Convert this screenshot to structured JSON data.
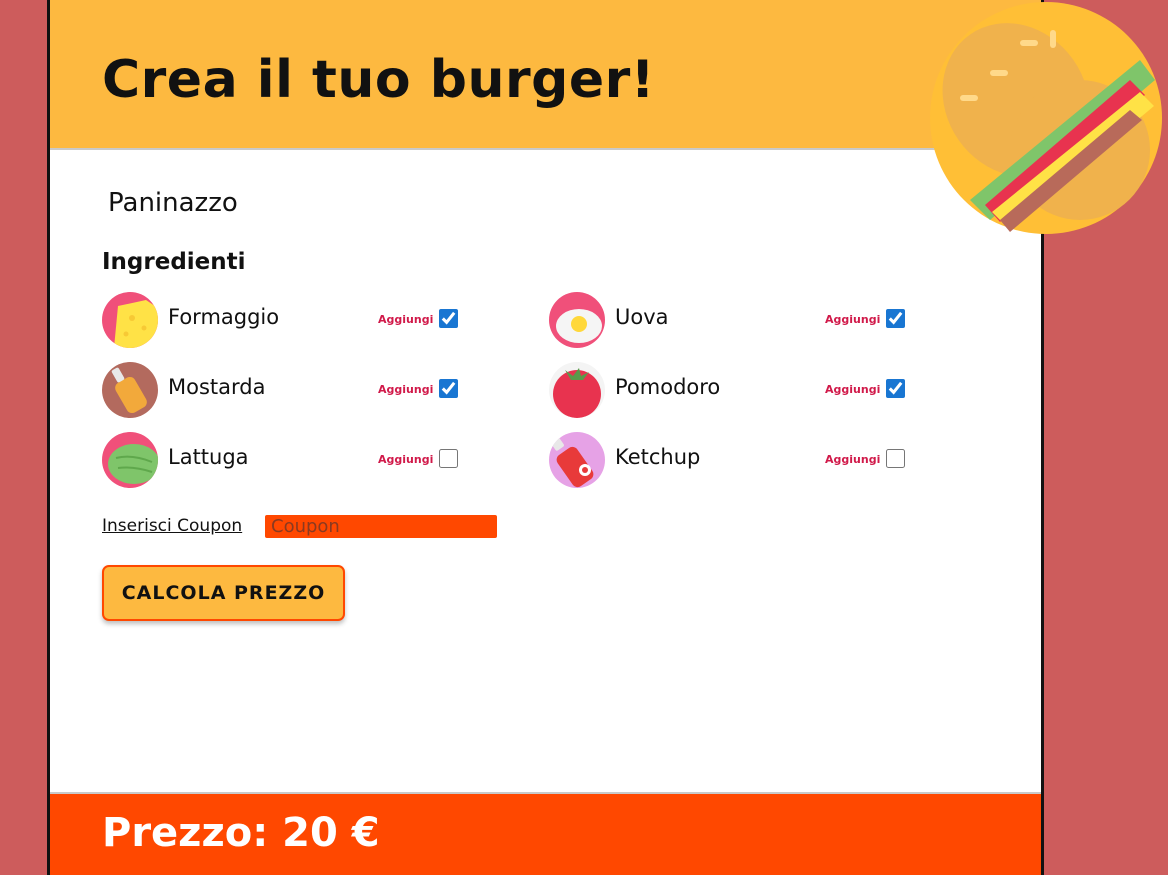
{
  "header": {
    "title": "Crea il tuo burger!"
  },
  "product": {
    "name": "Paninazzo"
  },
  "ingredients_section": {
    "title": "Ingredienti"
  },
  "ingredients": [
    {
      "name": "Formaggio",
      "add_label": "Aggiungi",
      "checked": true,
      "icon": "cheese-icon"
    },
    {
      "name": "Uova",
      "add_label": "Aggiungi",
      "checked": true,
      "icon": "egg-icon"
    },
    {
      "name": "Mostarda",
      "add_label": "Aggiungi",
      "checked": true,
      "icon": "mustard-icon"
    },
    {
      "name": "Pomodoro",
      "add_label": "Aggiungi",
      "checked": true,
      "icon": "tomato-icon"
    },
    {
      "name": "Lattuga",
      "add_label": "Aggiungi",
      "checked": false,
      "icon": "lettuce-icon"
    },
    {
      "name": "Ketchup",
      "add_label": "Aggiungi",
      "checked": false,
      "icon": "ketchup-icon"
    }
  ],
  "coupon": {
    "label": "Inserisci Coupon",
    "placeholder": "Coupon",
    "value": ""
  },
  "actions": {
    "calculate_label": "CALCOLA PREZZO"
  },
  "footer": {
    "price_text": "Prezzo: 20 €"
  },
  "colors": {
    "background": "#cd5c5c",
    "header": "#fdb940",
    "accent": "#ff4800",
    "checkbox": "#1976d2",
    "add_label": "#d11a4a"
  }
}
